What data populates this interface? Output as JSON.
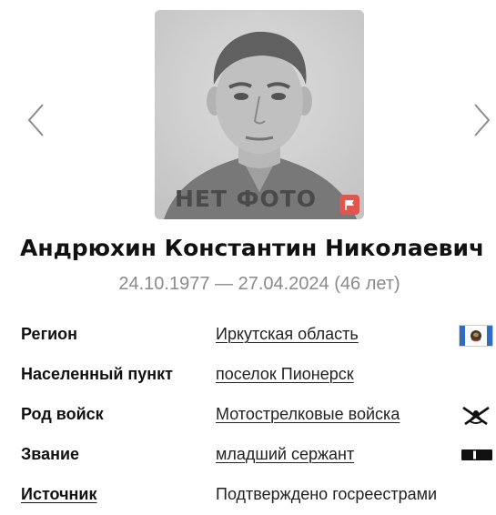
{
  "photo": {
    "placeholder_text": "НЕТ ФОТО",
    "report_icon": "flag-icon",
    "report_color": "#e0564f"
  },
  "carousel": {
    "prev_icon": "chevron-left-icon",
    "next_icon": "chevron-right-icon"
  },
  "person": {
    "name": "Андрюхин Константин Николаевич",
    "dates": "24.10.1977 — 27.04.2024 (46 лет)"
  },
  "details": [
    {
      "label": "Регион",
      "value": "Иркутская область",
      "icon": "irkutsk-flag-icon"
    },
    {
      "label": "Населенный пункт",
      "value": "поселок Пионерск",
      "icon": ""
    },
    {
      "label": "Род войск",
      "value": "Мотострелковые войска",
      "icon": "motor-rifle-emblem-icon"
    },
    {
      "label": "Звание",
      "value": "младший сержант",
      "icon": "rank-insignia-icon"
    },
    {
      "label": "Источник",
      "value": "Подтверждено госреестрами",
      "icon": ""
    }
  ]
}
